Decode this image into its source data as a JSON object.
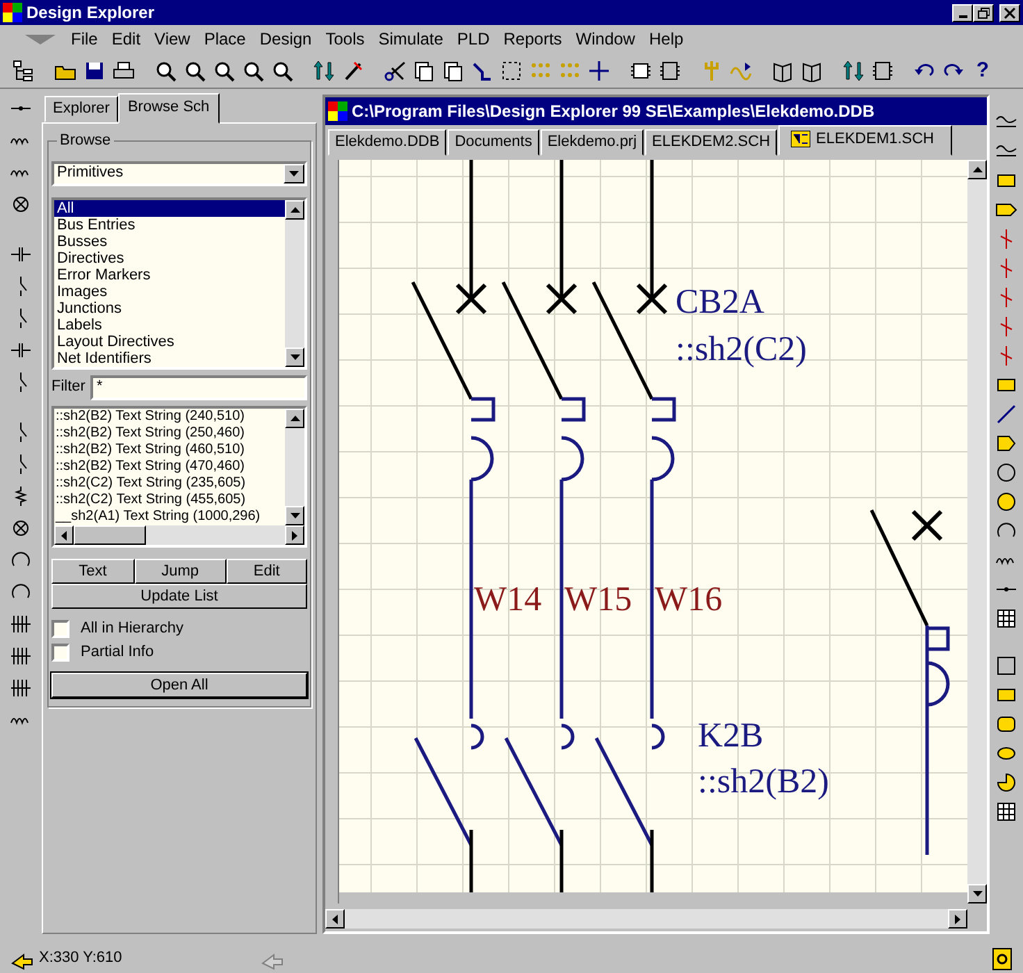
{
  "window": {
    "title": "Design Explorer"
  },
  "menu": [
    "File",
    "Edit",
    "View",
    "Place",
    "Design",
    "Tools",
    "Simulate",
    "PLD",
    "Reports",
    "Window",
    "Help"
  ],
  "toolbar": {
    "help_glyph": "?"
  },
  "panel": {
    "tabs": [
      {
        "label": "Explorer",
        "selected": false
      },
      {
        "label": "Browse Sch",
        "selected": true
      }
    ],
    "browse": {
      "legend": "Browse",
      "dropdown": "Primitives",
      "items": [
        {
          "label": "All",
          "selected": true
        },
        {
          "label": "Bus Entries",
          "selected": false
        },
        {
          "label": "Busses",
          "selected": false
        },
        {
          "label": "Directives",
          "selected": false
        },
        {
          "label": "Error Markers",
          "selected": false
        },
        {
          "label": "Images",
          "selected": false
        },
        {
          "label": "Junctions",
          "selected": false
        },
        {
          "label": "Labels",
          "selected": false
        },
        {
          "label": "Layout Directives",
          "selected": false
        },
        {
          "label": "Net Identifiers",
          "selected": false
        }
      ],
      "filter_label": "Filter",
      "filter_value": "*",
      "results": [
        "::sh2(B2) Text String (240,510)",
        "::sh2(B2) Text String (250,460)",
        "::sh2(B2) Text String (460,510)",
        "::sh2(B2) Text String (470,460)",
        "::sh2(C2) Text String (235,605)",
        "::sh2(C2) Text String (455,605)",
        "__sh2(A1) Text String (1000,296)"
      ],
      "buttons": [
        "Text",
        "Jump",
        "Edit"
      ],
      "update_button": "Update List",
      "options": [
        {
          "label": "All in Hierarchy",
          "checked": false
        },
        {
          "label": "Partial Info",
          "checked": false
        }
      ],
      "open_all_button": "Open All"
    }
  },
  "document": {
    "title": "C:\\Program Files\\Design Explorer 99 SE\\Examples\\Elekdemo.DDB",
    "tabs": [
      {
        "label": "Elekdemo.DDB",
        "selected": false
      },
      {
        "label": "Documents",
        "selected": false
      },
      {
        "label": "Elekdemo.prj",
        "selected": false
      },
      {
        "label": "ELEKDEM2.SCH",
        "selected": false
      },
      {
        "label": "ELEKDEM1.SCH",
        "selected": true
      }
    ],
    "schematic": {
      "breaker_labels": [
        "CB2A",
        "::sh2(C2)"
      ],
      "wire_labels": [
        "W14",
        "W15",
        "W16"
      ],
      "contactor_labels": [
        "K2B",
        "::sh2(B2)"
      ]
    }
  },
  "status_bar": {
    "coordinates": "X:330 Y:610"
  }
}
